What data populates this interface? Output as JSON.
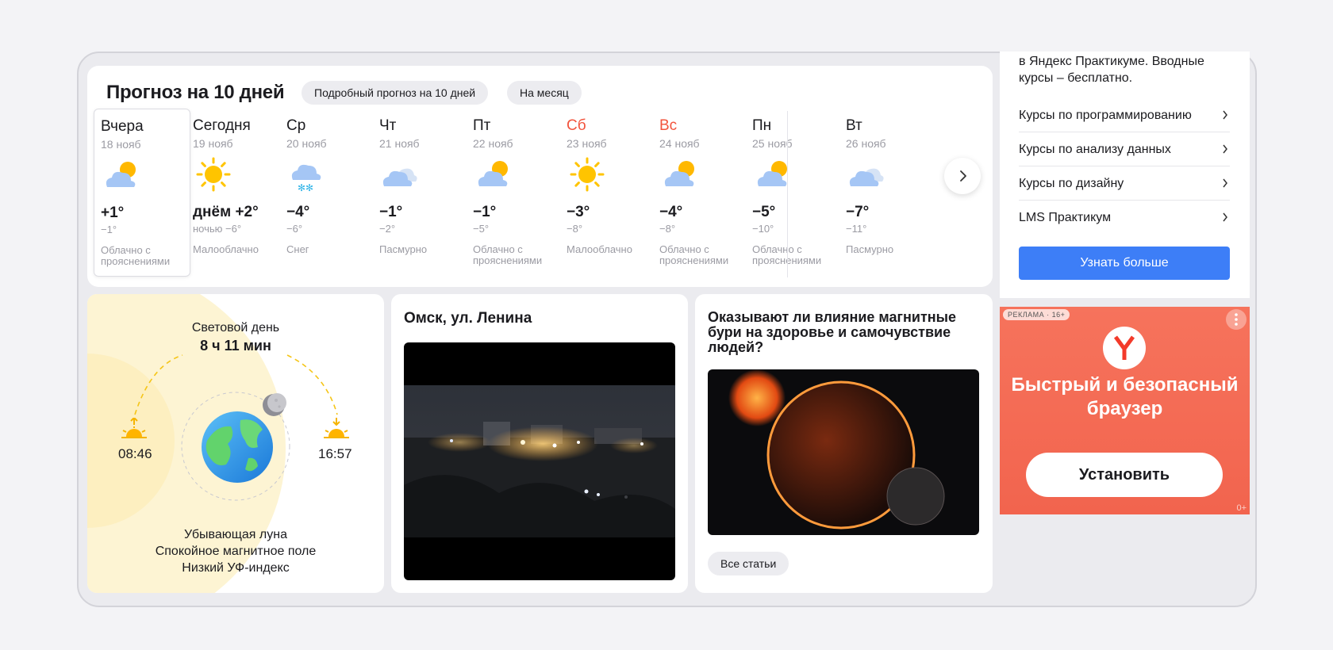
{
  "forecast": {
    "title": "Прогноз на 10 дней",
    "detailed_label": "Подробный прогноз на 10 дней",
    "month_label": "На месяц",
    "days": [
      {
        "name": "Вчера",
        "date": "18 нояб",
        "icon": "partly-cloudy-icon",
        "temp": "+1°",
        "night": "−1°",
        "desc": "Облачно с прояснениями",
        "weekend": false
      },
      {
        "name": "Сегодня",
        "date": "19 нояб",
        "icon": "sun-icon",
        "temp": "днём +2°",
        "night": "ночью −6°",
        "desc": "Малооблачно",
        "weekend": false
      },
      {
        "name": "Ср",
        "date": "20 нояб",
        "icon": "snow-icon",
        "temp": "−4°",
        "night": "−6°",
        "desc": "Снег",
        "weekend": false
      },
      {
        "name": "Чт",
        "date": "21 нояб",
        "icon": "overcast-icon",
        "temp": "−1°",
        "night": "−2°",
        "desc": "Пасмурно",
        "weekend": false
      },
      {
        "name": "Пт",
        "date": "22 нояб",
        "icon": "partly-cloudy-icon",
        "temp": "−1°",
        "night": "−5°",
        "desc": "Облачно с прояснениями",
        "weekend": false
      },
      {
        "name": "Сб",
        "date": "23 нояб",
        "icon": "sun-icon",
        "temp": "−3°",
        "night": "−8°",
        "desc": "Малооблачно",
        "weekend": true
      },
      {
        "name": "Вс",
        "date": "24 нояб",
        "icon": "partly-cloudy-icon",
        "temp": "−4°",
        "night": "−8°",
        "desc": "Облачно с прояснениями",
        "weekend": true
      },
      {
        "name": "Пн",
        "date": "25 нояб",
        "icon": "partly-cloudy-icon",
        "temp": "−5°",
        "night": "−10°",
        "desc": "Облачно с прояснениями",
        "weekend": false
      },
      {
        "name": "Вт",
        "date": "26 нояб",
        "icon": "overcast-icon",
        "temp": "−7°",
        "night": "−11°",
        "desc": "Пасмурно",
        "weekend": false
      }
    ]
  },
  "daylight": {
    "label": "Световой день",
    "duration": "8 ч 11 мин",
    "sunrise": "08:46",
    "sunset": "16:57",
    "moon": "Убывающая луна",
    "magnetic": "Спокойное магнитное поле",
    "uv": "Низкий УФ-индекс"
  },
  "webcam": {
    "title": "Омск, ул. Ленина"
  },
  "article": {
    "title": "Оказывают ли влияние магнитные бури на здоровье и самочувствие людей?",
    "all_label": "Все статьи"
  },
  "sidebar": {
    "intro": "в Яндекс Практикуме. Вводные курсы – бесплатно.",
    "links": [
      "Курсы по программированию",
      "Курсы по анализу данных",
      "Курсы по дизайну",
      "LMS Практикум"
    ],
    "button": "Узнать больше"
  },
  "ad": {
    "badge": "РЕКЛАМА · 16+",
    "text_line1": "Быстрый и безопасный",
    "text_line2": "браузер",
    "button": "Установить",
    "age": "0+",
    "logo_letter": "Y",
    "bg_color": "#f46a53"
  }
}
